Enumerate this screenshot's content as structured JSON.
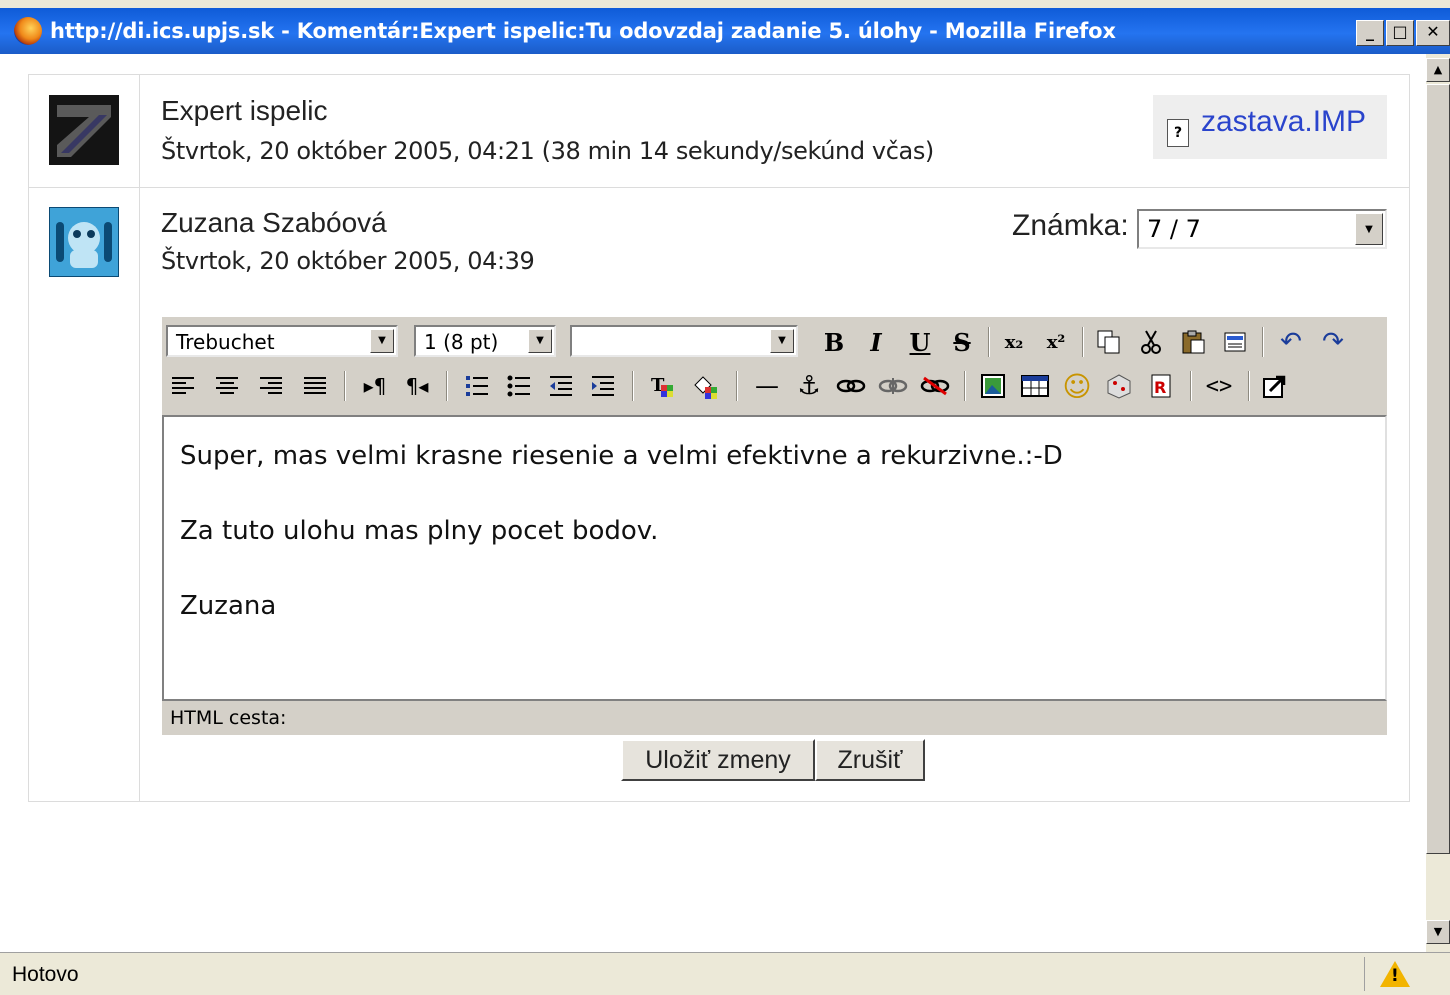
{
  "window": {
    "title": "http://di.ics.upjs.sk - Komentár:Expert ispelic:Tu odovzdaj zadanie 5. úlohy - Mozilla Firefox",
    "minimize": "_",
    "maximize": "□",
    "close": "✕"
  },
  "post": {
    "author": "Expert ispelic",
    "date": "Štvrtok, 20 október 2005, 04:21 (38 min 14 sekundy/sekúnd včas)",
    "attachment": "zastava.IMP"
  },
  "comment": {
    "author": "Zuzana Szabóová",
    "date": "Štvrtok, 20 október 2005, 04:39",
    "grade_label": "Známka:",
    "grade_value": "7 / 7"
  },
  "editor": {
    "font": "Trebuchet",
    "size": "1 (8 pt)",
    "format": "",
    "lines": [
      "Super, mas velmi krasne riesenie a velmi efektivne a rekurzivne.:-D",
      "Za tuto ulohu mas plny pocet bodov.",
      "Zuzana"
    ],
    "path_label": "HTML cesta:",
    "tools": {
      "bold": "B",
      "italic": "I",
      "underline": "U",
      "strike": "S",
      "subscript": "x₂",
      "superscript": "x²",
      "undo": "↶",
      "redo": "↷",
      "hr": "—",
      "anchor": "⚓",
      "smiley": "☺",
      "source": "<>"
    }
  },
  "buttons": {
    "save": "Uložiť zmeny",
    "cancel": "Zrušiť"
  },
  "status": {
    "text": "Hotovo",
    "warning": "!"
  },
  "colors": {
    "titlebar": "#1b5cc8",
    "link": "#2a44cc",
    "chrome": "#d4d0c8"
  }
}
